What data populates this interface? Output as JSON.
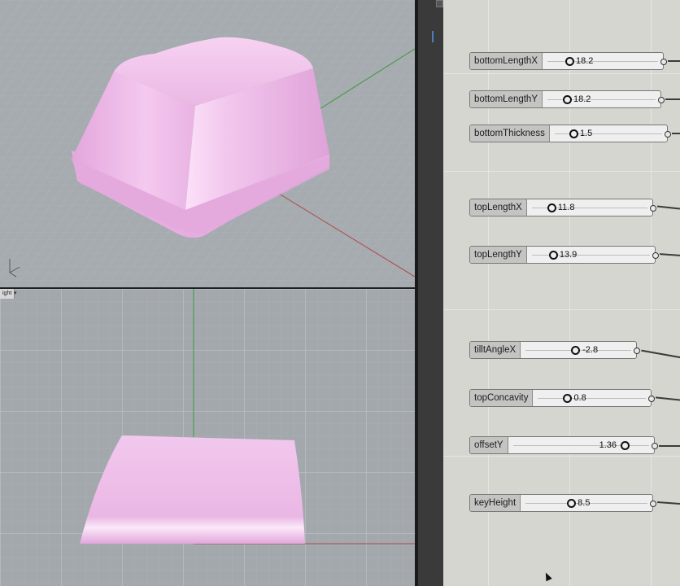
{
  "viewports": {
    "perspective": {
      "label": ""
    },
    "right": {
      "label": "ight"
    }
  },
  "sliders": [
    {
      "name": "bottomLengthX",
      "value": "18.2"
    },
    {
      "name": "bottomLengthY",
      "value": "18.2"
    },
    {
      "name": "bottomThickness",
      "value": "1.5"
    },
    {
      "name": "topLengthX",
      "value": "11.8"
    },
    {
      "name": "topLengthY",
      "value": "13.9"
    },
    {
      "name": "tilltAngleX",
      "value": "-2.8"
    },
    {
      "name": "topConcavity",
      "value": "0.8"
    },
    {
      "name": "offsetY",
      "value": "1.36"
    },
    {
      "name": "keyHeight",
      "value": "8.5"
    }
  ],
  "colors": {
    "keycap": "#f0c4ec",
    "viewport_bg": "#a6abb0",
    "gh_canvas": "#d6d6d1"
  }
}
